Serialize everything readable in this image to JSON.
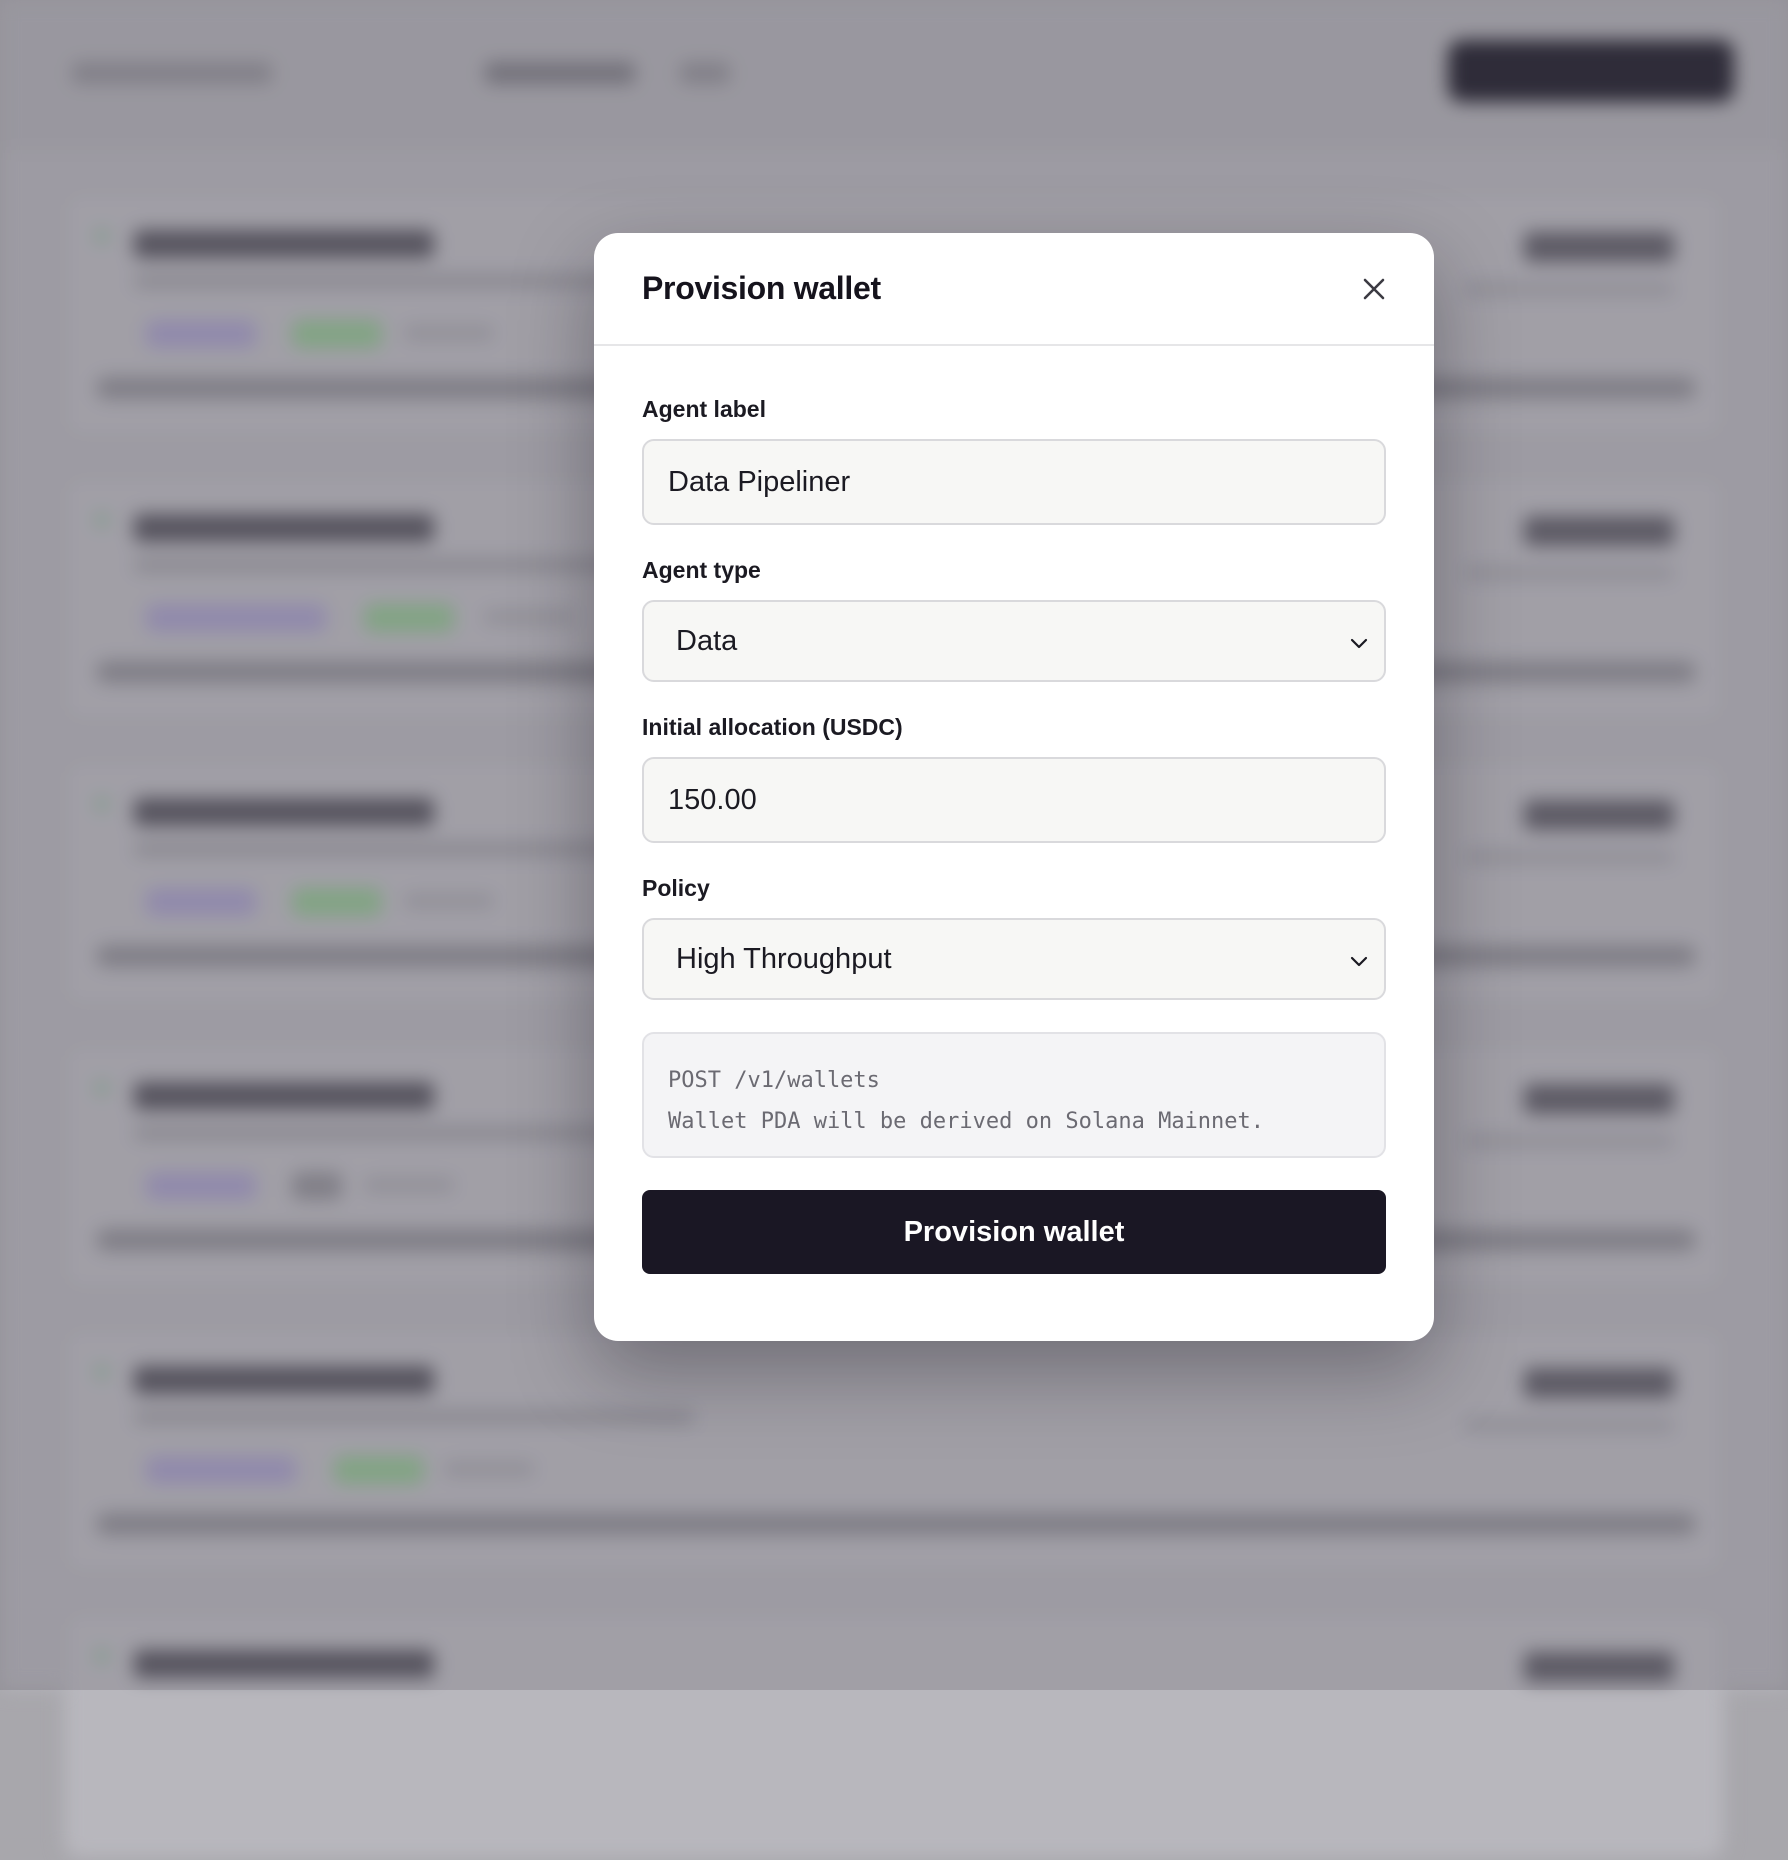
{
  "modal": {
    "title": "Provision wallet",
    "close_icon": "close-icon"
  },
  "form": {
    "agent_label": {
      "label": "Agent label",
      "value": "Data Pipeliner"
    },
    "agent_type": {
      "label": "Agent type",
      "selected": "Data",
      "chevron_icon": "chevron-down-icon"
    },
    "initial_allocation": {
      "label": "Initial allocation (USDC)",
      "value": "150.00"
    },
    "policy": {
      "label": "Policy",
      "selected": "High Throughput",
      "chevron_icon": "chevron-down-icon"
    },
    "info": {
      "line1": "POST /v1/wallets",
      "line2": "Wallet PDA will be derived on Solana Mainnet."
    },
    "submit_label": "Provision wallet"
  },
  "colors": {
    "primary_button": "#1a1724",
    "input_background": "#f7f7f5",
    "overlay_background": "#a8a7ac"
  }
}
